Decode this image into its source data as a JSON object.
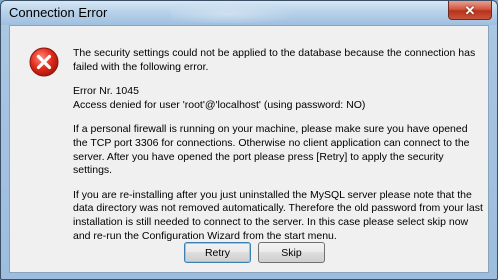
{
  "window": {
    "title": "Connection Error",
    "close_glyph": "✕"
  },
  "icon": {
    "name": "error-icon",
    "color": "#e02b1b"
  },
  "message": {
    "para1": "The security settings could not be applied to the database because the connection has failed with the following error.",
    "para2_line1": "Error Nr. 1045",
    "para2_line2": "Access denied for user 'root'@'localhost' (using password: NO)",
    "para3": "If a personal firewall is running on your machine, please make sure you have opened the TCP port 3306 for connections. Otherwise no client application can connect to the server. After you have opened the port please press [Retry] to apply the security settings.",
    "para4": "If you are re-installing after you just uninstalled the MySQL server please note that the data directory was not removed automatically. Therefore the old password from your last installation is still needed to connect to the server. In this case please select skip now and re-run the Configuration Wizard from the start menu."
  },
  "buttons": {
    "retry_label": "Retry",
    "skip_label": "Skip"
  }
}
